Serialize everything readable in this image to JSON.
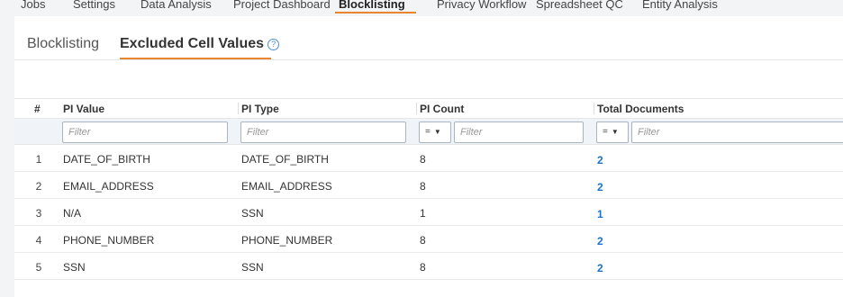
{
  "top_nav": {
    "items": [
      {
        "label": "Jobs"
      },
      {
        "label": "Settings"
      },
      {
        "label": "Data Analysis"
      },
      {
        "label": "Project Dashboard"
      },
      {
        "label": "Blocklisting",
        "active": true
      },
      {
        "label": "Privacy Workflow"
      },
      {
        "label": "Spreadsheet QC"
      },
      {
        "label": "Entity Analysis"
      }
    ]
  },
  "subtabs": {
    "blocklisting": "Blocklisting",
    "excluded_cell_values": "Excluded Cell Values",
    "help_icon": "?"
  },
  "table": {
    "columns": {
      "num": "#",
      "pi_value": "PI Value",
      "pi_type": "PI Type",
      "pi_count": "PI Count",
      "total_documents": "Total Documents"
    },
    "filters": {
      "placeholder": "Filter",
      "operator": "="
    },
    "rows": [
      {
        "num": "1",
        "pi_value": "DATE_OF_BIRTH",
        "pi_type": "DATE_OF_BIRTH",
        "pi_count": "8",
        "total_documents": "2"
      },
      {
        "num": "2",
        "pi_value": "EMAIL_ADDRESS",
        "pi_type": "EMAIL_ADDRESS",
        "pi_count": "8",
        "total_documents": "2"
      },
      {
        "num": "3",
        "pi_value": "N/A",
        "pi_type": "SSN",
        "pi_count": "1",
        "total_documents": "1"
      },
      {
        "num": "4",
        "pi_value": "PHONE_NUMBER",
        "pi_type": "PHONE_NUMBER",
        "pi_count": "8",
        "total_documents": "2"
      },
      {
        "num": "5",
        "pi_value": "SSN",
        "pi_type": "SSN",
        "pi_count": "8",
        "total_documents": "2"
      }
    ]
  },
  "colors": {
    "accent": "#e8852e",
    "link": "#1a73d1"
  }
}
